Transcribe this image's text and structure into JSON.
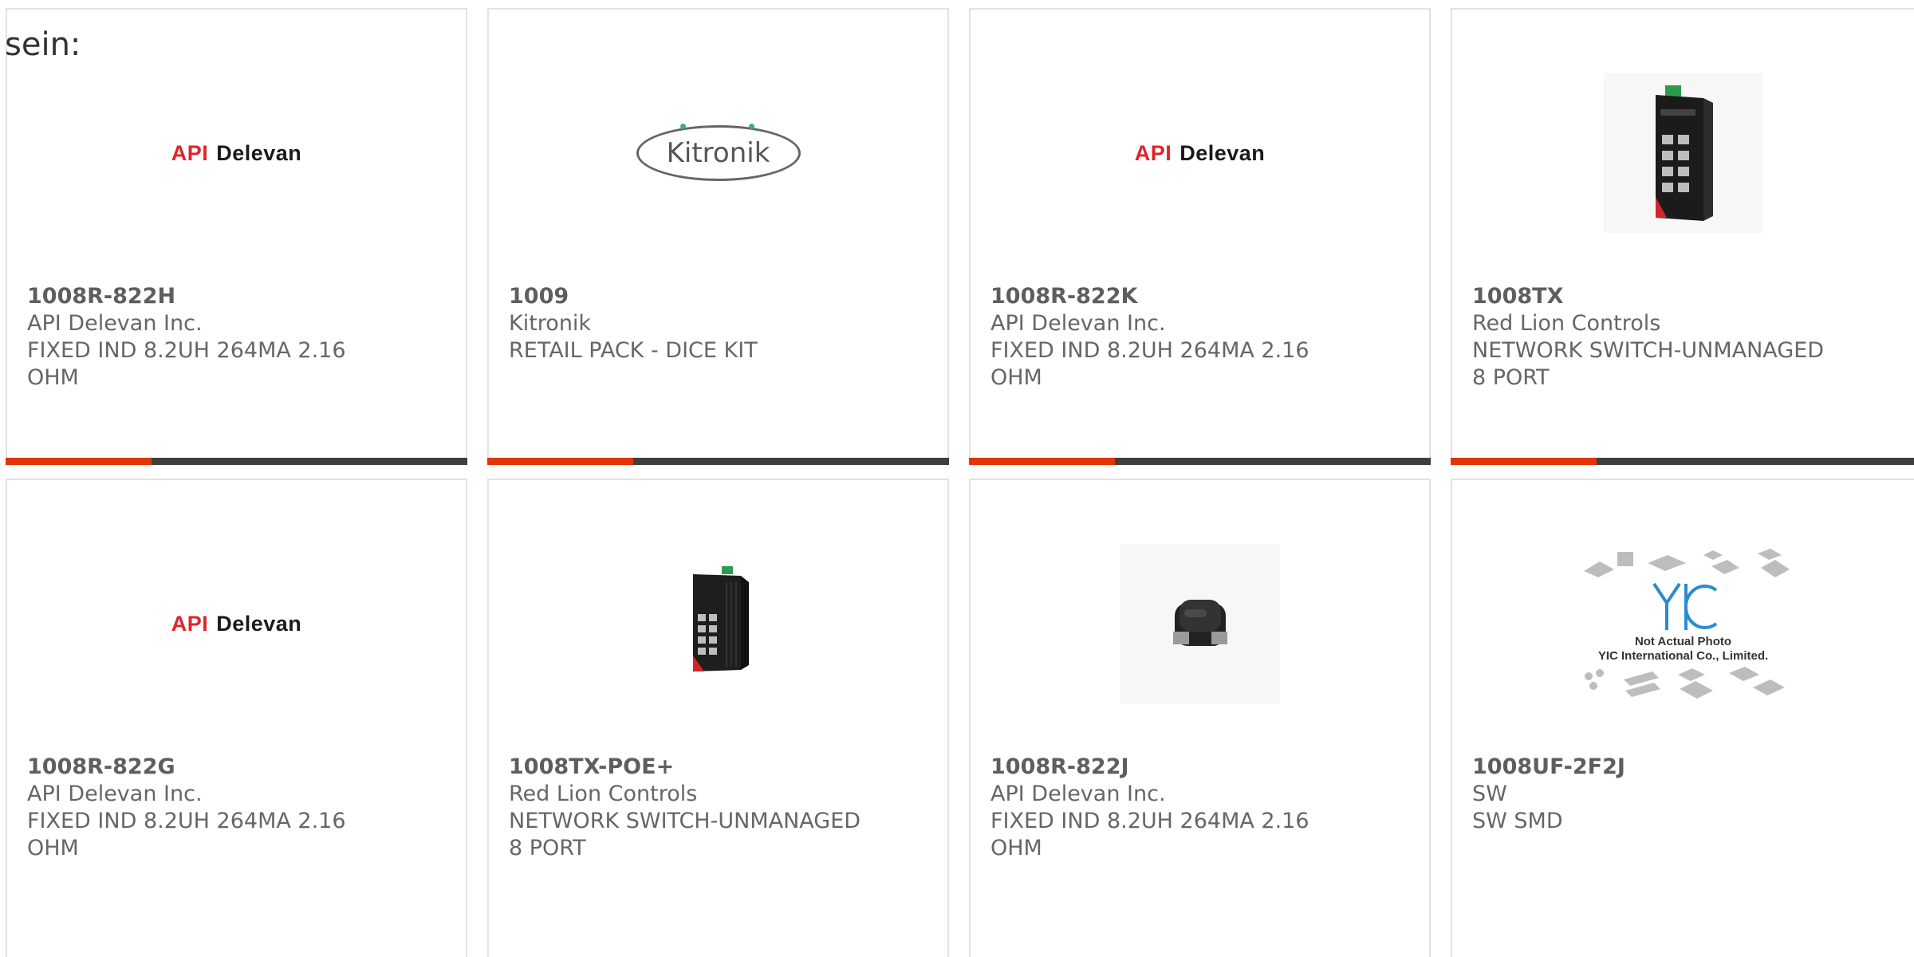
{
  "heading": "sein:",
  "cards": [
    {
      "part": "1008R-822H",
      "maker": "API Delevan Inc.",
      "desc": [
        "FIXED IND 8.2UH 264MA 2.16",
        "OHM"
      ],
      "image": "api-delevan-logo"
    },
    {
      "part": "1009",
      "maker": "Kitronik",
      "desc": [
        "RETAIL PACK - DICE KIT"
      ],
      "image": "kitronik-logo"
    },
    {
      "part": "1008R-822K",
      "maker": "API Delevan Inc.",
      "desc": [
        "FIXED IND 8.2UH 264MA 2.16",
        "OHM"
      ],
      "image": "api-delevan-logo"
    },
    {
      "part": "1008TX",
      "maker": "Red Lion Controls",
      "desc": [
        "NETWORK SWITCH-UNMANAGED",
        "8 PORT"
      ],
      "image": "network-switch-photo"
    },
    {
      "part": "1008R-822G",
      "maker": "API Delevan Inc.",
      "desc": [
        "FIXED IND 8.2UH 264MA 2.16",
        "OHM"
      ],
      "image": "api-delevan-logo"
    },
    {
      "part": "1008TX-POE+",
      "maker": "Red Lion Controls",
      "desc": [
        "NETWORK SWITCH-UNMANAGED",
        "8 PORT"
      ],
      "image": "network-switch-poe-photo"
    },
    {
      "part": "1008R-822J",
      "maker": "API Delevan Inc.",
      "desc": [
        "FIXED IND 8.2UH 264MA 2.16",
        "OHM"
      ],
      "image": "inductor-photo"
    },
    {
      "part": "1008UF-2F2J",
      "maker": "SW",
      "desc": [
        "SW SMD"
      ],
      "image": "yic-placeholder"
    }
  ],
  "logos": {
    "api_delevan": {
      "api": "API",
      "delevan": "Delevan"
    },
    "kitronik": "Kitronik",
    "yic": {
      "mark": "YIC",
      "note1": "Not Actual Photo",
      "note2": "YIC International Co., Limited."
    }
  },
  "colors": {
    "accent": "#e23500",
    "bar": "#3f3f3f",
    "api_red": "#e0242b"
  }
}
